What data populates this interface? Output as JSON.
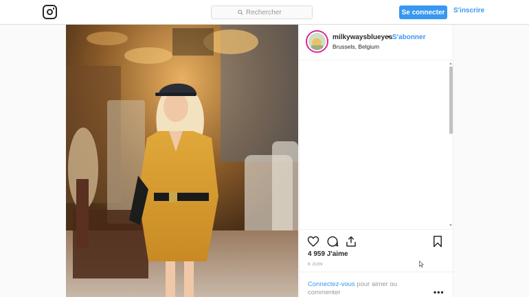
{
  "header": {
    "search_placeholder": "Rechercher",
    "login_label": "Se connecter",
    "signup_label": "S'inscrire",
    "logo_icon": "instagram-icon"
  },
  "post": {
    "username": "milkywaysblueyes",
    "separator": "•",
    "follow_label": "S'abonner",
    "location": "Brussels, Belgium",
    "likes": "4 959 J'aime",
    "date": "6 JUIN",
    "comment_prompt_link": "Connectez-vous",
    "comment_prompt_rest": " pour aimer ou commenter",
    "more_label": "•••"
  },
  "icons": [
    "heart-icon",
    "comment-icon",
    "share-icon",
    "bookmark-icon",
    "more-options-icon"
  ],
  "colors": {
    "accent": "#3897f0",
    "border": "#dbdbdb",
    "text": "#262626",
    "muted": "#999999"
  }
}
